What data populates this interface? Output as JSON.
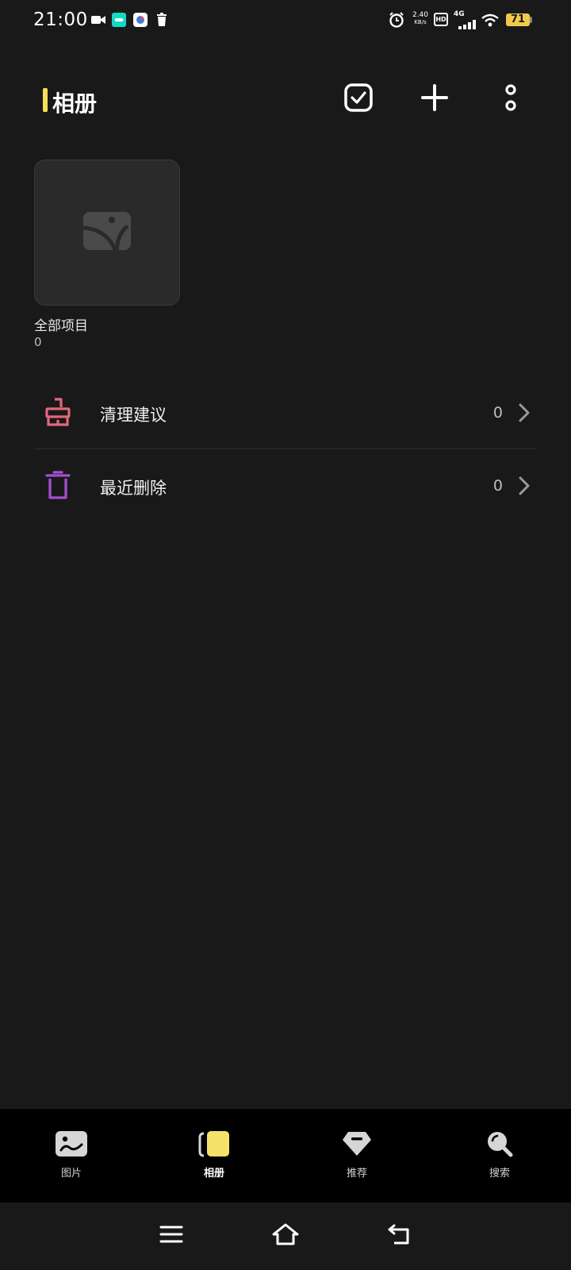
{
  "status_bar": {
    "time": "21:00",
    "net_speed_value": "2.40",
    "net_speed_unit": "KB/s",
    "hd_label": "HD",
    "network_label": "4G",
    "battery": "71",
    "icons": [
      "video-camera-icon",
      "taptap-app-icon",
      "app-icon",
      "trash-icon",
      "alarm-icon",
      "signal-icon",
      "wifi-icon",
      "battery-icon"
    ]
  },
  "header": {
    "title": "相册",
    "accent_color": "#f3df5b",
    "actions": [
      "select-checkbox-icon",
      "plus-icon",
      "more-icon"
    ]
  },
  "albums": [
    {
      "name": "全部项目",
      "count": "0"
    }
  ],
  "list": [
    {
      "label": "清理建议",
      "count": "0",
      "icon": "brush-icon",
      "icon_color": "#e2677c"
    },
    {
      "label": "最近删除",
      "count": "0",
      "icon": "trash-icon",
      "icon_color": "#a64fd1"
    }
  ],
  "tabs": [
    {
      "label": "图片",
      "icon": "photo-icon",
      "active": false
    },
    {
      "label": "相册",
      "icon": "album-icon",
      "active": true
    },
    {
      "label": "推荐",
      "icon": "diamond-icon",
      "active": false
    },
    {
      "label": "搜索",
      "icon": "search-icon",
      "active": false
    }
  ],
  "system_nav": [
    "menu-icon",
    "home-icon",
    "back-icon"
  ]
}
